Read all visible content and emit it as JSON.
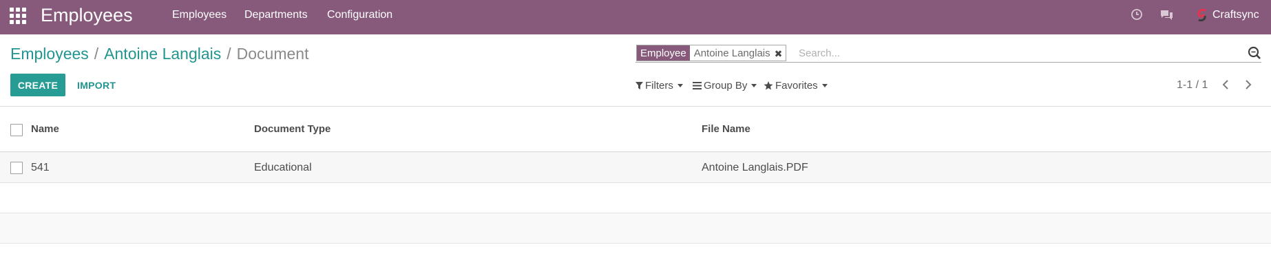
{
  "navbar": {
    "app_title": "Employees",
    "menu": [
      "Employees",
      "Departments",
      "Configuration"
    ],
    "company": "Craftsync",
    "colors": {
      "primary": "#875a7b",
      "accent": "#21958f"
    },
    "icons": [
      "apps-grid-icon",
      "clock-icon",
      "chat-icon",
      "company-logo-icon"
    ]
  },
  "breadcrumb": {
    "items": [
      "Employees",
      "Antoine Langlais"
    ],
    "separator": "/",
    "active": "Document"
  },
  "search": {
    "facet_label": "Employee",
    "facet_value": "Antoine Langlais",
    "facet_remove": "✖",
    "placeholder": "Search..."
  },
  "buttons": {
    "create": "CREATE",
    "import": "IMPORT"
  },
  "filters": {
    "filters": "Filters",
    "group_by": "Group By",
    "favorites": "Favorites"
  },
  "pager": {
    "text": "1-1 / 1"
  },
  "table": {
    "columns": [
      "Name",
      "Document Type",
      "File Name"
    ],
    "rows": [
      {
        "name": "541",
        "document_type": "Educational",
        "file_name": "Antoine Langlais.PDF"
      }
    ]
  }
}
